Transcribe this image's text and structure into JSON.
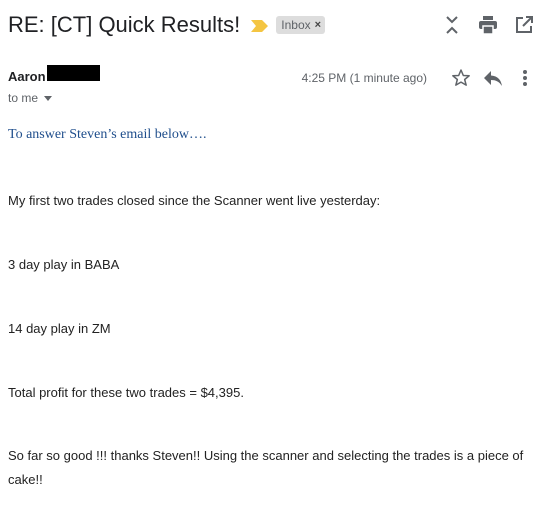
{
  "subject": "RE: [CT] Quick Results!",
  "label_chip": "Inbox",
  "chip_close": "×",
  "sender": {
    "name": "Aaron",
    "to": "to me"
  },
  "timestamp": "4:25 PM (1 minute ago)",
  "body": {
    "intro": "To answer Steven’s email below….",
    "line1": "My first two trades closed since the Scanner went live yesterday:",
    "line2": "3 day play in BABA",
    "line3": "14 day play in ZM",
    "line4": "Total profit for these two trades = $4,395.",
    "line5": "So far so good !!!  thanks Steven!!  Using the scanner and selecting the trades is a piece of cake!!"
  },
  "colors": {
    "importance": "#f4c542",
    "intro_text": "#1f4e8c",
    "chip_bg": "#dddddd"
  },
  "icons": [
    "importance-marker-icon",
    "expand-collapse-icon",
    "print-icon",
    "open-new-window-icon",
    "star-icon",
    "reply-icon",
    "more-vert-icon",
    "chevron-down-icon"
  ]
}
